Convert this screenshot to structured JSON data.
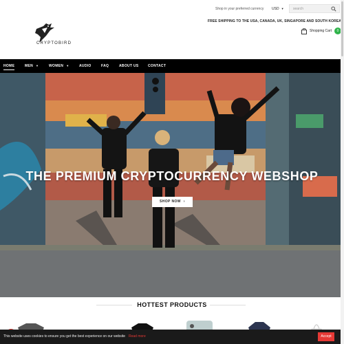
{
  "header": {
    "currency_note": "Shop in your preferred currency",
    "currency": "USD",
    "search_placeholder": "search",
    "shipping": "FREE SHIPPING TO THE USA, CANADA, UK, SINGAPORE AND SOUTH KOREA",
    "logo_text": "CRYPTOBIRD",
    "cart_label": "Shopping Cart",
    "cart_count": "0"
  },
  "nav": {
    "items": [
      {
        "label": "HOME"
      },
      {
        "label": "MEN"
      },
      {
        "label": "WOMEN"
      },
      {
        "label": "AUDIO"
      },
      {
        "label": "FAQ"
      },
      {
        "label": "ABOUT US"
      },
      {
        "label": "CONTACT"
      }
    ]
  },
  "hero": {
    "title": "THE PREMIUM CRYPTOCURRENCY WEBSHOP",
    "button_label": "SHOP NOW",
    "button_arrow": "›"
  },
  "products": {
    "section_title": "HOTTEST PRODUCTS"
  },
  "cookie": {
    "message": "This website uses cookies to ensure you get the best experience on our website",
    "more_link": "Read more",
    "accept_label": "Accept"
  },
  "colors": {
    "nav_bg": "#000000",
    "accent_green": "#2fb34a",
    "cookie_accent": "#e53935"
  }
}
